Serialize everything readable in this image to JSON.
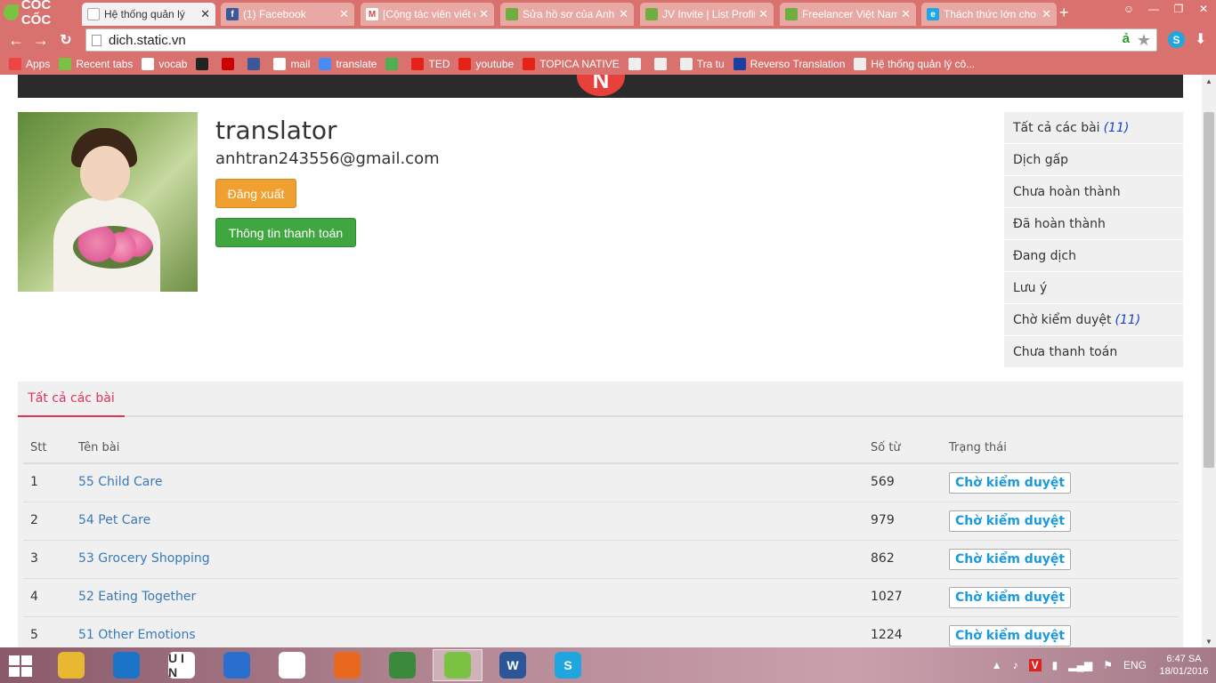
{
  "browser": {
    "brand": "CỐC CỐC",
    "tabs": [
      {
        "title": "Hệ thống quản lý",
        "active": true,
        "icon": "page-icon"
      },
      {
        "title": "(1) Facebook",
        "active": false,
        "icon": "facebook-icon"
      },
      {
        "title": "[Cộng tác viên viết c",
        "active": false,
        "icon": "gmail-icon"
      },
      {
        "title": "Sửa hồ sơ của Anh T",
        "active": false,
        "icon": "upwork-icon"
      },
      {
        "title": "JV Invite | List Profit",
        "active": false,
        "icon": "upwork-icon"
      },
      {
        "title": "Freelancer Việt Nam",
        "active": false,
        "icon": "upwork-icon"
      },
      {
        "title": "Thách thức lớn cho",
        "active": false,
        "icon": "ie-icon"
      }
    ],
    "url": "dich.static.vn",
    "bookmarks": [
      {
        "label": "Apps",
        "icon": "apps-icon",
        "color": "#e44"
      },
      {
        "label": "Recent tabs",
        "icon": "recent-tabs-icon",
        "color": "#7cc242"
      },
      {
        "label": "vocab",
        "icon": "vocab-icon",
        "color": "#fff"
      },
      {
        "label": "",
        "icon": "bbc-icon",
        "color": "#222"
      },
      {
        "label": "",
        "icon": "cnn-icon",
        "color": "#cc0000"
      },
      {
        "label": "",
        "icon": "facebook-icon",
        "color": "#3b5998"
      },
      {
        "label": "mail",
        "icon": "google-icon",
        "color": "#fff"
      },
      {
        "label": "translate",
        "icon": "translate-icon",
        "color": "#4a8af4"
      },
      {
        "label": "",
        "icon": "chrome-store-icon",
        "color": "#4caf50"
      },
      {
        "label": "TED",
        "icon": "youtube-icon",
        "color": "#e62117"
      },
      {
        "label": "youtube",
        "icon": "youtube-icon",
        "color": "#e62117"
      },
      {
        "label": "TOPICA NATIVE",
        "icon": "youtube-icon",
        "color": "#e62117"
      },
      {
        "label": "",
        "icon": "page-icon",
        "color": "#eee"
      },
      {
        "label": "",
        "icon": "page-icon",
        "color": "#eee"
      },
      {
        "label": "Tra tu",
        "icon": "page-icon",
        "color": "#eee"
      },
      {
        "label": "Reverso Translation",
        "icon": "reverso-icon",
        "color": "#1a3fa0"
      },
      {
        "label": "Hệ thống quản lý cô...",
        "icon": "page-icon",
        "color": "#eee"
      }
    ]
  },
  "profile": {
    "name": "translator",
    "email": "anhtran243556@gmail.com",
    "logout_label": "Đăng xuất",
    "payment_label": "Thông tin thanh toán"
  },
  "sidemenu": [
    {
      "label": "Tất cả các bài",
      "count": "(11)"
    },
    {
      "label": "Dịch gấp",
      "count": ""
    },
    {
      "label": "Chưa hoàn thành",
      "count": ""
    },
    {
      "label": "Đã hoàn thành",
      "count": ""
    },
    {
      "label": "Đang dịch",
      "count": ""
    },
    {
      "label": "Lưu ý",
      "count": ""
    },
    {
      "label": "Chờ kiểm duyệt",
      "count": "(11)"
    },
    {
      "label": "Chưa thanh toán",
      "count": ""
    }
  ],
  "panel": {
    "tab_label": "Tất cả các bài",
    "columns": [
      "Stt",
      "Tên bài",
      "Số từ",
      "Trạng thái"
    ],
    "rows": [
      {
        "stt": "1",
        "title": "55 Child Care",
        "words": "569",
        "status": "Chờ kiểm duyệt"
      },
      {
        "stt": "2",
        "title": "54 Pet Care",
        "words": "979",
        "status": "Chờ kiểm duyệt"
      },
      {
        "stt": "3",
        "title": "53 Grocery Shopping",
        "words": "862",
        "status": "Chờ kiểm duyệt"
      },
      {
        "stt": "4",
        "title": "52 Eating Together",
        "words": "1027",
        "status": "Chờ kiểm duyệt"
      },
      {
        "stt": "5",
        "title": "51 Other Emotions",
        "words": "1224",
        "status": "Chờ kiểm duyệt"
      }
    ]
  },
  "taskbar": {
    "apps": [
      {
        "name": "file-explorer-icon",
        "color": "#e8b830",
        "label": ""
      },
      {
        "name": "teamviewer-icon",
        "color": "#1c74c8",
        "label": ""
      },
      {
        "name": "unikey-icon",
        "color": "#ffffff",
        "label": "U I N"
      },
      {
        "name": "media-player-icon",
        "color": "#2a6fd0",
        "label": ""
      },
      {
        "name": "mtd-icon",
        "color": "#ffffff",
        "label": ""
      },
      {
        "name": "firefox-icon",
        "color": "#e8691e",
        "label": ""
      },
      {
        "name": "chrome-icon",
        "color": "#3b8a3b",
        "label": ""
      },
      {
        "name": "coccoc-icon",
        "color": "#7cc242",
        "label": ""
      },
      {
        "name": "word-icon",
        "color": "#2b579a",
        "label": "W"
      },
      {
        "name": "skype-icon",
        "color": "#1fa5e0",
        "label": "S"
      }
    ],
    "lang": "ENG",
    "time": "6:47 SA",
    "date": "18/01/2016"
  },
  "colors": {
    "chrome": "#d9726f",
    "accent_tab": "#e0335b",
    "logout": "#f0a030",
    "payment": "#40a640",
    "status_text": "#1b9adf",
    "link": "#3a7ab8"
  }
}
